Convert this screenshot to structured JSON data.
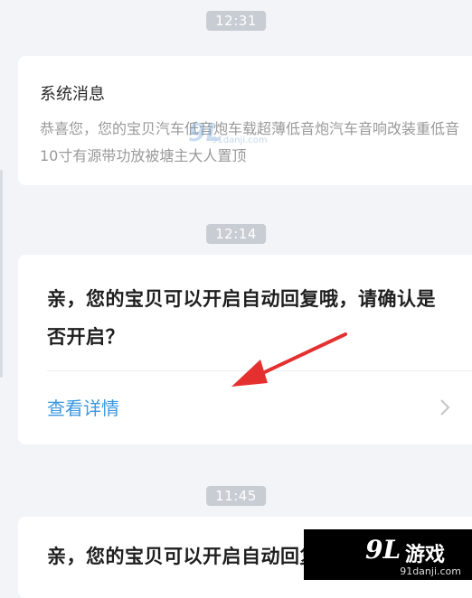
{
  "timestamps": [
    "12:31",
    "12:14",
    "11:45"
  ],
  "system_message": {
    "title": "系统消息",
    "body": "恭喜您，您的宝贝汽车低音炮车载超薄低音炮汽车音响改装重低音10寸有源带功放被塘主大人置顶"
  },
  "message_1": {
    "title": "亲，您的宝贝可以开启自动回复哦，请确认是否开启？",
    "link_label": "查看详情"
  },
  "message_2": {
    "title": "亲，您的宝贝可以开启自动回复哦，请"
  },
  "watermark": {
    "logo_mark": "9L",
    "logo_text": "游戏",
    "logo_url": "91danji.com",
    "overlay_mark": "9L",
    "overlay_url": "91danji.com"
  },
  "colors": {
    "link": "#3a97e0",
    "arrow": "#e53030",
    "timestamp_bg": "#c8ccd3"
  },
  "icons": {
    "chevron": "chevron-right-icon",
    "annotation": "red-arrow-annotation"
  }
}
